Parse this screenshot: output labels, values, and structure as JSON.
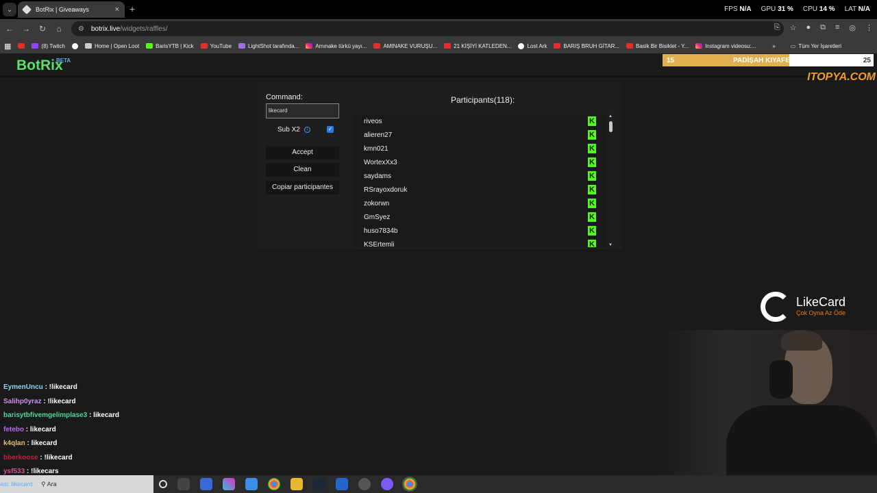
{
  "browser": {
    "tab_title": "BotRix | Giveaways",
    "new_tab_glyph": "+",
    "close_glyph": "×",
    "url_host": "botrix.live",
    "url_path": "/widgets/raffles/",
    "stats": [
      {
        "label": "FPS",
        "value": "N/A"
      },
      {
        "label": "GPU",
        "value": "31 %"
      },
      {
        "label": "CPU",
        "value": "14 %"
      },
      {
        "label": "LAT",
        "value": "N/A"
      }
    ],
    "bookmarks": [
      {
        "label": "",
        "icon": "youtube-icon"
      },
      {
        "label": "(8) Twitch",
        "icon": "twitch-icon"
      },
      {
        "label": "",
        "icon": "google-icon"
      },
      {
        "label": "Home | Open Loot",
        "icon": "openloot-icon"
      },
      {
        "label": "BarisYTB | Kick",
        "icon": "kick-icon"
      },
      {
        "label": "YouTube",
        "icon": "youtube-icon"
      },
      {
        "label": "LightShot tarafında...",
        "icon": "lightshot-icon"
      },
      {
        "label": "Amınake türkü yayı...",
        "icon": "instagram-icon"
      },
      {
        "label": "AMINAKE VURUŞU...",
        "icon": "youtube-icon"
      },
      {
        "label": "21 KİŞİYİ KATLEDEN...",
        "icon": "youtube-icon"
      },
      {
        "label": "Lost Ark",
        "icon": "lostark-icon"
      },
      {
        "label": "BARIŞ BRUH GİTAR...",
        "icon": "youtube-icon"
      },
      {
        "label": "Basik Bir Bisiklet - Y...",
        "icon": "youtube-icon"
      },
      {
        "label": "Instagram videosu:...",
        "icon": "instagram-icon"
      }
    ],
    "bookmarks_more": "»",
    "all_bookmarks": "Tüm Yer İşaretleri"
  },
  "site": {
    "brand": "BotRix",
    "beta": "BETA"
  },
  "overlay": {
    "left_num": "15",
    "name": "PADİŞAH KIYAFETİ",
    "right_num": "25",
    "progress": 0.6,
    "sponsor": "ITOPYA.COM"
  },
  "raffle": {
    "command_label": "Command:",
    "command_value": "likecard",
    "sub_label": "Sub X2",
    "sub_checked": true,
    "accept": "Accept",
    "clean": "Clean",
    "copy": "Copiar participantes",
    "participants_title": "Participants(118):",
    "participants": [
      "riveos",
      "alieren27",
      "kmn021",
      "WortexXx3",
      "saydams",
      "RSrayoxdoruk",
      "zokorwn",
      "GmSyez",
      "huso7834b",
      "KSErtemli"
    ]
  },
  "likecard": {
    "name": "LikeCard",
    "tagline": "Çok Oyna  Az Öde"
  },
  "chat": [
    {
      "user": "EymenUncu",
      "text": " : !likecard",
      "color": "#8fd6f0"
    },
    {
      "user": "Salihp0yraz",
      "text": " : !likecard",
      "color": "#d08ff0"
    },
    {
      "user": "barisytbfivemgelimplase3",
      "text": " : likecard",
      "color": "#4fd6a0"
    },
    {
      "user": "fetebo",
      "text": " : likecard",
      "color": "#b06af0"
    },
    {
      "user": "k4qlan",
      "text": " : likecard",
      "color": "#e0c070"
    },
    {
      "user": "bberkoose",
      "text": " : !likecard",
      "color": "#c02040"
    },
    {
      "user": "ysf533",
      "text": " : !likecars",
      "color": "#d05090"
    }
  ],
  "taskbar": {
    "search_text": "Ara",
    "partial_chat": "asi: likecard"
  }
}
